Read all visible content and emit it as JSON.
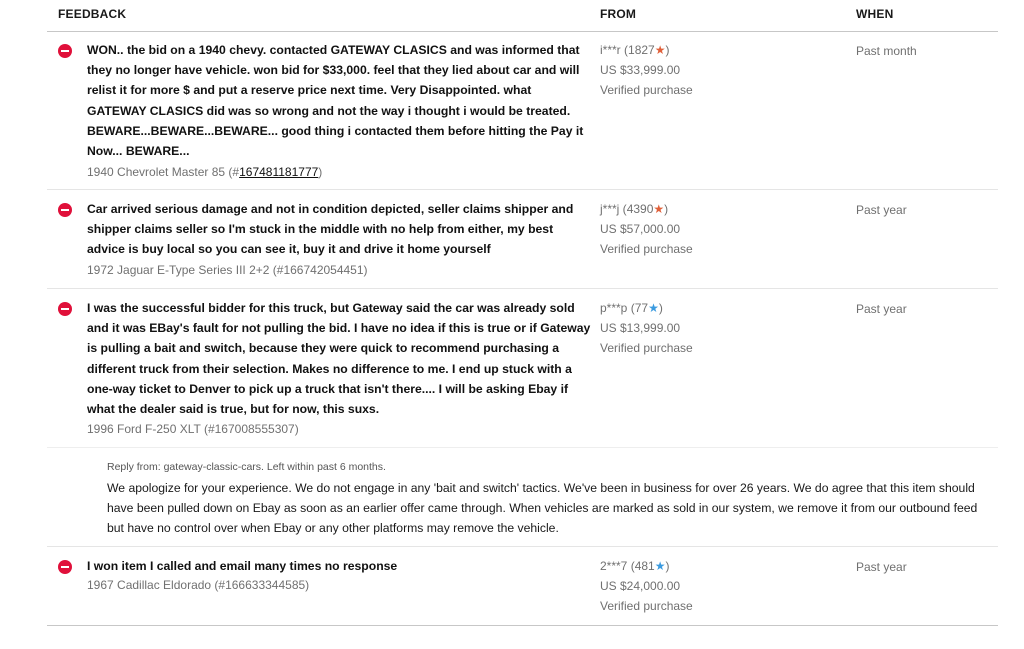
{
  "header": {
    "feedback": "FEEDBACK",
    "from": "FROM",
    "when": "WHEN"
  },
  "colors": {
    "negative": "#e0103a",
    "star_red": "#e0603a",
    "star_blue": "#3b9be0"
  },
  "rows": [
    {
      "rating": "negative",
      "comment": "WON.. the bid on a 1940 chevy. contacted GATEWAY CLASICS and was informed that they no longer have vehicle. won bid for $33,000. feel that they lied about car and will relist it for more $ and put a reserve price next time. Very Disappointed. what GATEWAY CLASICS did was so wrong and not the way i thought i would be treated. BEWARE...BEWARE...BEWARE... good thing i contacted them before hitting the Pay it Now... BEWARE...",
      "item_prefix": "1940 Chevrolet Master 85 (#",
      "item_number": "167481181777",
      "item_suffix": ")",
      "user": "i***r",
      "score": "1827",
      "star_color": "red",
      "price": "US $33,999.00",
      "verified": "Verified purchase",
      "when": "Past month"
    },
    {
      "rating": "negative",
      "comment": "Car arrived serious damage and not in condition depicted, seller claims shipper and shipper claims seller so I'm stuck in the middle with no help from either, my best advice is buy local so you can see it, buy it and drive it home yourself",
      "item": "1972 Jaguar E-Type Series III 2+2 (#166742054451)",
      "user": "j***j",
      "score": "4390",
      "star_color": "red",
      "price": "US $57,000.00",
      "verified": "Verified purchase",
      "when": "Past year"
    },
    {
      "rating": "negative",
      "comment": "I was the successful bidder for this truck, but Gateway said the car was already sold and it was EBay's fault for not pulling the bid. I have no idea if this is true or if Gateway is pulling a bait and switch, because they were quick to recommend purchasing a different truck from their selection. Makes no difference to me. I end up stuck with a one-way ticket to Denver to pick up a truck that isn't there.... I will be asking Ebay if what the dealer said is true, but for now, this suxs.",
      "item": "1996 Ford F-250 XLT (#167008555307)",
      "user": "p***p",
      "score": "77",
      "star_color": "blue",
      "price": "US $13,999.00",
      "verified": "Verified purchase",
      "when": "Past year"
    },
    {
      "rating": "negative",
      "comment": "I won item I called and email many times no response",
      "item": "1967 Cadillac Eldorado (#166633344585)",
      "user": "2***7",
      "score": "481",
      "star_color": "blue",
      "price": "US $24,000.00",
      "verified": "Verified purchase",
      "when": "Past year"
    }
  ],
  "reply": {
    "from": "Reply from: gateway-classic-cars. Left within past 6 months.",
    "text": "We apologize for your experience. We do not engage in any 'bait and switch' tactics. We've been in business for over 26 years. We do agree that this item should have been pulled down on Ebay as soon as an earlier offer came through. When vehicles are marked as sold in our system, we remove it from our outbound feed but have no control over when Ebay or any other platforms may remove the vehicle."
  }
}
